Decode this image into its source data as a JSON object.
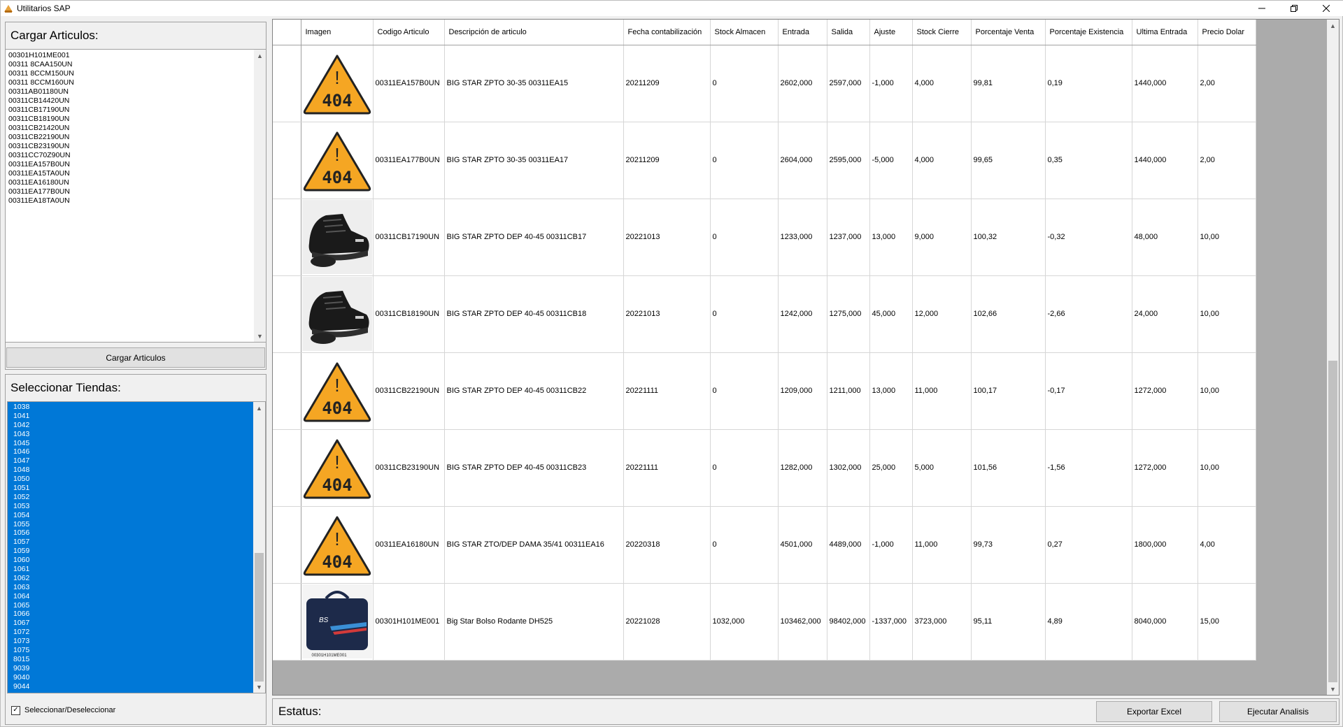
{
  "window": {
    "title": "Utilitarios SAP"
  },
  "articulos": {
    "title": "Cargar Articulos:",
    "items": [
      "00301H101ME001",
      "00311 8CAA150UN",
      "00311 8CCM150UN",
      "00311 8CCM160UN",
      "00311AB01180UN",
      "00311CB14420UN",
      "00311CB17190UN",
      "00311CB18190UN",
      "00311CB21420UN",
      "00311CB22190UN",
      "00311CB23190UN",
      "00311CC70Z90UN",
      "00311EA157B0UN",
      "00311EA15TA0UN",
      "00311EA16180UN",
      "00311EA177B0UN",
      "00311EA18TA0UN"
    ],
    "button_label": "Cargar Articulos"
  },
  "tiendas": {
    "title": "Seleccionar Tiendas:",
    "items": [
      "1038",
      "1041",
      "1042",
      "1043",
      "1045",
      "1046",
      "1047",
      "1048",
      "1050",
      "1051",
      "1052",
      "1053",
      "1054",
      "1055",
      "1056",
      "1057",
      "1059",
      "1060",
      "1061",
      "1062",
      "1063",
      "1064",
      "1065",
      "1066",
      "1067",
      "1072",
      "1073",
      "1075",
      "8015",
      "9039",
      "9040",
      "9044"
    ],
    "checkbox_label": "Seleccionar/Deseleccionar",
    "checkbox_checked": true
  },
  "grid": {
    "columns": [
      "Imagen",
      "Codigo Articulo",
      "Descripción de articulo",
      "Fecha contabilización",
      "Stock Almacen",
      "Entrada",
      "Salida",
      "Ajuste",
      "Stock Cierre",
      "Porcentaje Venta",
      "Porcentaje Existencia",
      "Ultima Entrada",
      "Precio Dolar"
    ],
    "rows": [
      {
        "image": "404",
        "codigo": "00311EA157B0UN",
        "descripcion": "BIG STAR ZPTO 30-35 00311EA15",
        "fecha": "20211209",
        "stock_almacen": "0",
        "entrada": "2602,000",
        "salida": "2597,000",
        "ajuste": "-1,000",
        "stock_cierre": "4,000",
        "pct_venta": "99,81",
        "pct_existencia": "0,19",
        "ultima_entrada": "1440,000",
        "precio_dolar": "2,00"
      },
      {
        "image": "404",
        "codigo": "00311EA177B0UN",
        "descripcion": "BIG STAR ZPTO 30-35 00311EA17",
        "fecha": "20211209",
        "stock_almacen": "0",
        "entrada": "2604,000",
        "salida": "2595,000",
        "ajuste": "-5,000",
        "stock_cierre": "4,000",
        "pct_venta": "99,65",
        "pct_existencia": "0,35",
        "ultima_entrada": "1440,000",
        "precio_dolar": "2,00"
      },
      {
        "image": "boot",
        "codigo": "00311CB17190UN",
        "descripcion": "BIG STAR ZPTO DEP 40-45 00311CB17",
        "fecha": "20221013",
        "stock_almacen": "0",
        "entrada": "1233,000",
        "salida": "1237,000",
        "ajuste": "13,000",
        "stock_cierre": "9,000",
        "pct_venta": "100,32",
        "pct_existencia": "-0,32",
        "ultima_entrada": "48,000",
        "precio_dolar": "10,00"
      },
      {
        "image": "boot",
        "codigo": "00311CB18190UN",
        "descripcion": "BIG STAR ZPTO DEP 40-45 00311CB18",
        "fecha": "20221013",
        "stock_almacen": "0",
        "entrada": "1242,000",
        "salida": "1275,000",
        "ajuste": "45,000",
        "stock_cierre": "12,000",
        "pct_venta": "102,66",
        "pct_existencia": "-2,66",
        "ultima_entrada": "24,000",
        "precio_dolar": "10,00"
      },
      {
        "image": "404",
        "codigo": "00311CB22190UN",
        "descripcion": "BIG STAR ZPTO DEP 40-45 00311CB22",
        "fecha": "20221111",
        "stock_almacen": "0",
        "entrada": "1209,000",
        "salida": "1211,000",
        "ajuste": "13,000",
        "stock_cierre": "11,000",
        "pct_venta": "100,17",
        "pct_existencia": "-0,17",
        "ultima_entrada": "1272,000",
        "precio_dolar": "10,00"
      },
      {
        "image": "404",
        "codigo": "00311CB23190UN",
        "descripcion": "BIG STAR ZPTO DEP 40-45 00311CB23",
        "fecha": "20221111",
        "stock_almacen": "0",
        "entrada": "1282,000",
        "salida": "1302,000",
        "ajuste": "25,000",
        "stock_cierre": "5,000",
        "pct_venta": "101,56",
        "pct_existencia": "-1,56",
        "ultima_entrada": "1272,000",
        "precio_dolar": "10,00"
      },
      {
        "image": "404",
        "codigo": "00311EA16180UN",
        "descripcion": "BIG STAR ZTO/DEP DAMA 35/41 00311EA16",
        "fecha": "20220318",
        "stock_almacen": "0",
        "entrada": "4501,000",
        "salida": "4489,000",
        "ajuste": "-1,000",
        "stock_cierre": "11,000",
        "pct_venta": "99,73",
        "pct_existencia": "0,27",
        "ultima_entrada": "1800,000",
        "precio_dolar": "4,00"
      },
      {
        "image": "bag",
        "codigo": "00301H101ME001",
        "descripcion": "Big Star Bolso Rodante DH525",
        "fecha": "20221028",
        "stock_almacen": "1032,000",
        "entrada": "103462,000",
        "salida": "98402,000",
        "ajuste": "-1337,000",
        "stock_cierre": "3723,000",
        "pct_venta": "95,11",
        "pct_existencia": "4,89",
        "ultima_entrada": "8040,000",
        "precio_dolar": "15,00"
      }
    ]
  },
  "placeholder_image_text": "404",
  "bag_caption": "00301H101ME001",
  "status": {
    "label": "Estatus:"
  },
  "buttons": {
    "export": "Exportar Excel",
    "execute": "Ejecutar Analisis"
  },
  "colors": {
    "selection": "#0078d7",
    "warning": "#f5a623",
    "grid_bg": "#ababab"
  }
}
